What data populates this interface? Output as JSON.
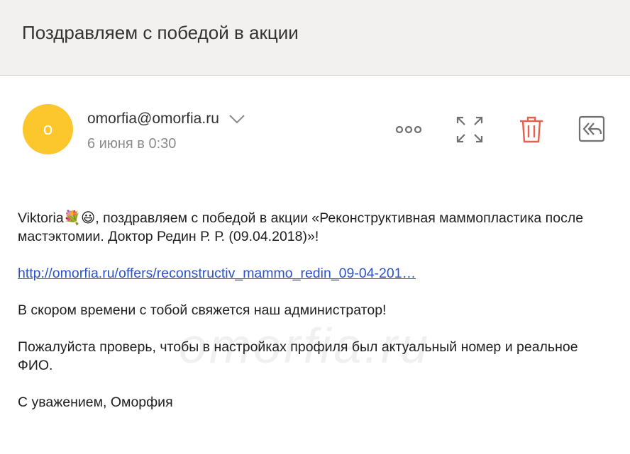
{
  "header": {
    "subject": "Поздравляем с победой в акции"
  },
  "message": {
    "avatar_letter": "о",
    "sender": "omorfia@omorfia.ru",
    "date": "6 июня в 0:30"
  },
  "toolbar": {
    "more_icon": "more-dots-icon",
    "expand_icon": "expand-icon",
    "delete_icon": "trash-icon",
    "reply_all_icon": "reply-all-icon",
    "delete_color": "#e8604c"
  },
  "body": {
    "greeting_name": "Viktoria",
    "emoji": "💐😃",
    "line1_text": ", поздравляем с победой в акции «Реконструктивная маммопластика после мастэктомии. Доктор Редин Р. Р. (09.04.2018)»!",
    "link_text": "http://omorfia.ru/offers/reconstructiv_mammo_redin_09-04-201…",
    "para2": "В скором времени с тобой свяжется наш администратор!",
    "para3": "Пожалуйста проверь, чтобы в настройках профиля был актуальный номер и реальное ФИО.",
    "signature": "С уважением, Оморфия"
  },
  "watermark": "omorfia.ru"
}
